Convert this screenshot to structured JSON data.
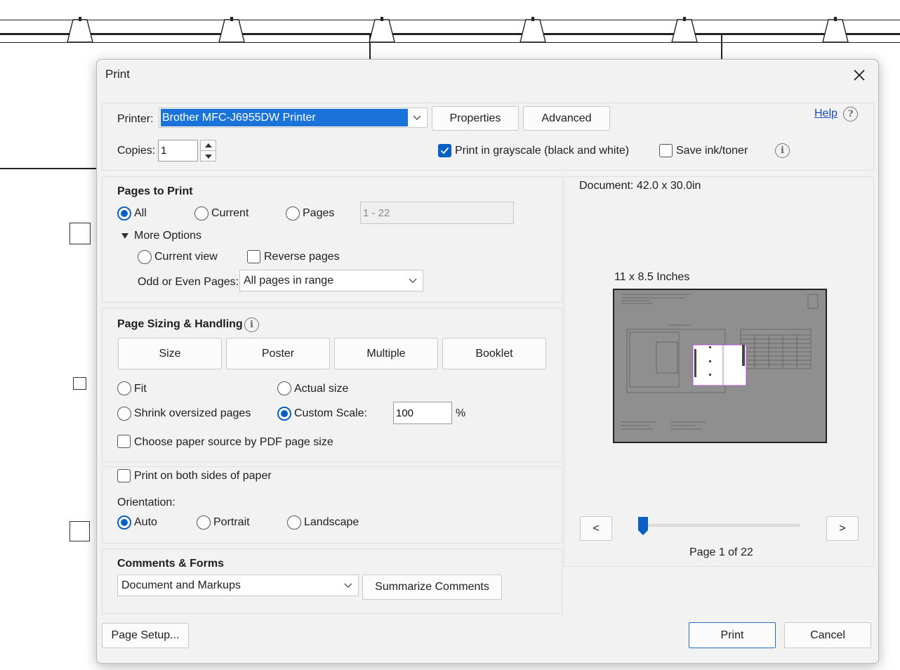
{
  "dialog": {
    "title": "Print",
    "printer_label": "Printer:",
    "printer_value": "Brother MFC-J6955DW Printer",
    "properties_label": "Properties",
    "advanced_label": "Advanced",
    "help_label": "Help",
    "copies_label": "Copies:",
    "copies_value": "1",
    "grayscale_label": "Print in grayscale (black and white)",
    "grayscale_checked": true,
    "save_ink_label": "Save ink/toner",
    "save_ink_checked": false
  },
  "pages_to_print": {
    "heading": "Pages to Print",
    "all_label": "All",
    "current_label": "Current",
    "pages_label": "Pages",
    "pages_range_placeholder": "1 - 22",
    "more_options_label": "More Options",
    "current_view_label": "Current view",
    "reverse_pages_label": "Reverse pages",
    "odd_even_label": "Odd or Even Pages:",
    "odd_even_value": "All pages in range",
    "selected": "All"
  },
  "page_sizing": {
    "heading": "Page Sizing & Handling",
    "tabs": [
      "Size",
      "Poster",
      "Multiple",
      "Booklet"
    ],
    "fit_label": "Fit",
    "actual_size_label": "Actual size",
    "shrink_label": "Shrink oversized pages",
    "custom_scale_label": "Custom Scale:",
    "custom_scale_value": "100",
    "percent_label": "%",
    "paper_source_label": "Choose paper source by PDF page size",
    "selected": "Custom Scale"
  },
  "duplex": {
    "both_sides_label": "Print on both sides of paper",
    "orientation_label": "Orientation:",
    "auto_label": "Auto",
    "portrait_label": "Portrait",
    "landscape_label": "Landscape",
    "selected": "Auto"
  },
  "comments_forms": {
    "heading": "Comments & Forms",
    "value": "Document and Markups",
    "summarize_label": "Summarize Comments"
  },
  "preview": {
    "document_size": "Document: 42.0 x 30.0in",
    "paper_size": "11 x 8.5 Inches",
    "prev_label": "<",
    "next_label": ">",
    "page_indicator": "Page 1 of 22",
    "current_page": 1,
    "total_pages": 22
  },
  "footer": {
    "page_setup_label": "Page Setup...",
    "print_label": "Print",
    "cancel_label": "Cancel"
  },
  "colors": {
    "accent": "#0a5fc4",
    "selection": "#1a73d9",
    "dialog_bg": "#f2f2f2"
  }
}
